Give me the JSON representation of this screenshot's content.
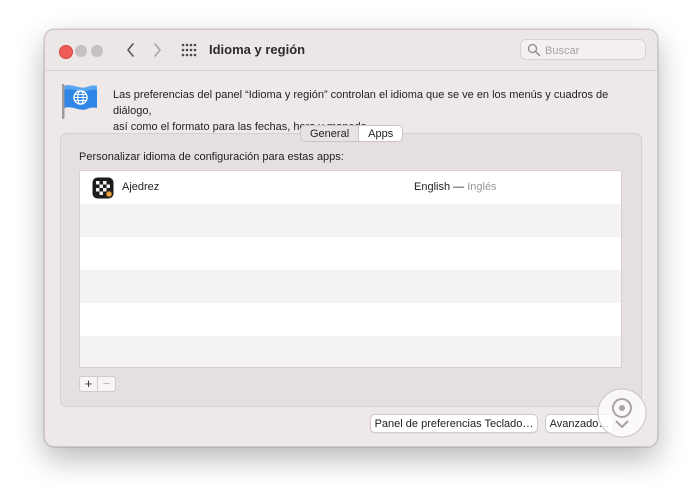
{
  "window": {
    "title": "Idioma y región"
  },
  "search": {
    "placeholder": "Buscar"
  },
  "header": {
    "description_line1": "Las preferencias del panel “Idioma y región” controlan el idioma que se ve en los menús y cuadros de diálogo,",
    "description_line2": "así como el formato para las fechas, hora y moneda."
  },
  "tabs": [
    {
      "label": "General",
      "active": false
    },
    {
      "label": "Apps",
      "active": true
    }
  ],
  "apps_panel": {
    "label": "Personalizar idioma de configuración para estas apps:",
    "apps": [
      {
        "name": "Ajedrez",
        "language": "English",
        "separator": " — ",
        "language_local": "Inglés",
        "icon": "chess-icon"
      }
    ]
  },
  "controls": {
    "add_label": "+",
    "remove_label": "−"
  },
  "buttons": {
    "keyboard_prefs": "Panel de preferencias Teclado…",
    "advanced": "Avanzado…"
  },
  "colors": {
    "close": "#ee5c55",
    "inactive_light": "#c6c0c0",
    "flag_blue": "#2f86e6",
    "window_bg": "#efe8e8"
  }
}
